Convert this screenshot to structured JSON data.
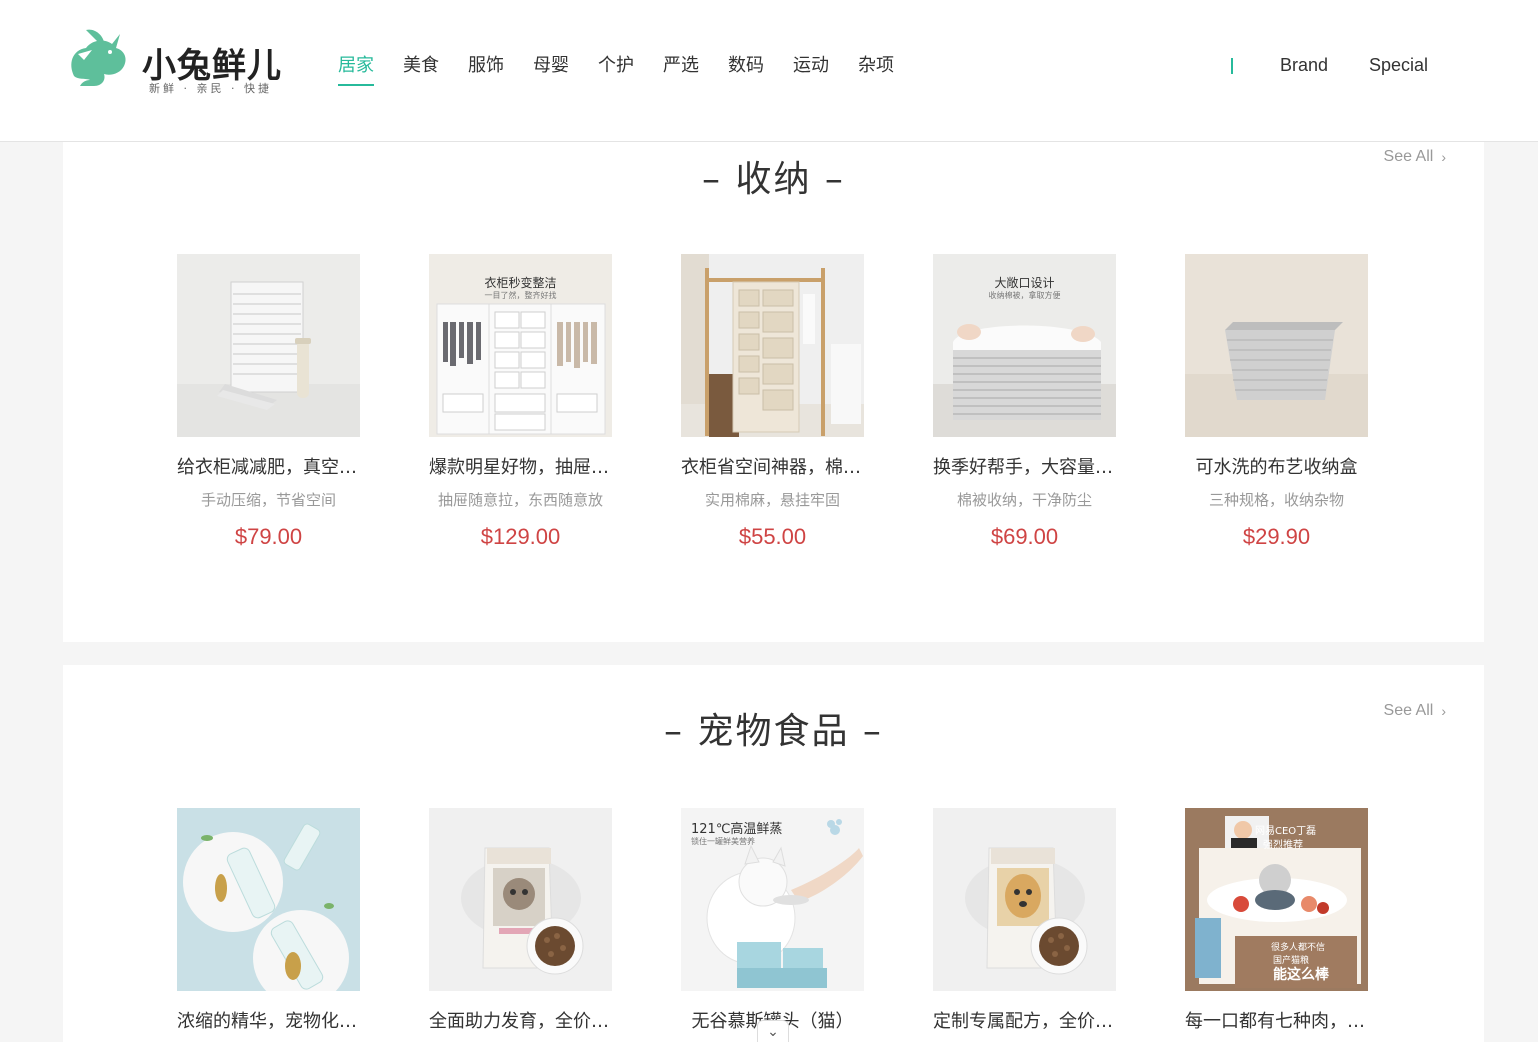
{
  "header": {
    "logo_text": "小兔鲜儿",
    "logo_slogan": "新鲜 · 亲民 · 快捷",
    "nav": [
      "居家",
      "美食",
      "服饰",
      "母婴",
      "个护",
      "严选",
      "数码",
      "运动",
      "杂项"
    ],
    "active_nav": "居家",
    "extra": [
      "Brand",
      "Special"
    ]
  },
  "colors": {
    "brand": "#27ba9b",
    "price": "#cf4444"
  },
  "sections": [
    {
      "title": "– 收纳 –",
      "see_all": "See All",
      "goods": [
        {
          "name": "给衣柜减减肥，真空压缩袋",
          "desc": "手动压缩，节省空间",
          "price": "$79.00",
          "icon": "vacuum-bag"
        },
        {
          "name": "爆款明星好物，抽屉式收纳箱",
          "desc": "抽屉随意拉，东西随意放",
          "price": "$129.00",
          "icon": "wardrobe",
          "img_title": "衣柜秒变整洁",
          "img_sub": "一目了然，整齐好找"
        },
        {
          "name": "衣柜省空间神器，棉麻悬挂收纳",
          "desc": "实用棉麻，悬挂牢固",
          "price": "$55.00",
          "icon": "hanging-organizer"
        },
        {
          "name": "换季好帮手，大容量棉被收纳袋",
          "desc": "棉被收纳，干净防尘",
          "price": "$69.00",
          "icon": "quilt-bag",
          "img_title": "大敞口设计",
          "img_sub": "收纳棉被，拿取方便"
        },
        {
          "name": "可水洗的布艺收纳盒",
          "desc": "三种规格，收纳杂物",
          "price": "$29.90",
          "icon": "fabric-box"
        }
      ]
    },
    {
      "title": "– 宠物食品 –",
      "see_all": "See All",
      "goods": [
        {
          "name": "浓缩的精华，宠物化毛膏",
          "icon": "pet-paste"
        },
        {
          "name": "全面助力发育，全价幼猫粮",
          "icon": "kitten-food"
        },
        {
          "name": "无谷慕斯罐头（猫）",
          "icon": "cat-can",
          "img_title": "121℃高温鲜蒸",
          "img_sub": "锁住一罐鲜美营养"
        },
        {
          "name": "定制专属配方，全价犬粮",
          "icon": "dog-food"
        },
        {
          "name": "每一口都有七种肉，全价猫粮",
          "icon": "ceo-cat-food",
          "img_title": "网易CEO丁磊",
          "img_sub": "强烈推荐",
          "img_quote_a": "很多人都不信",
          "img_quote_b": "国产猫粮",
          "img_quote_c": "能这么棒"
        }
      ]
    }
  ]
}
